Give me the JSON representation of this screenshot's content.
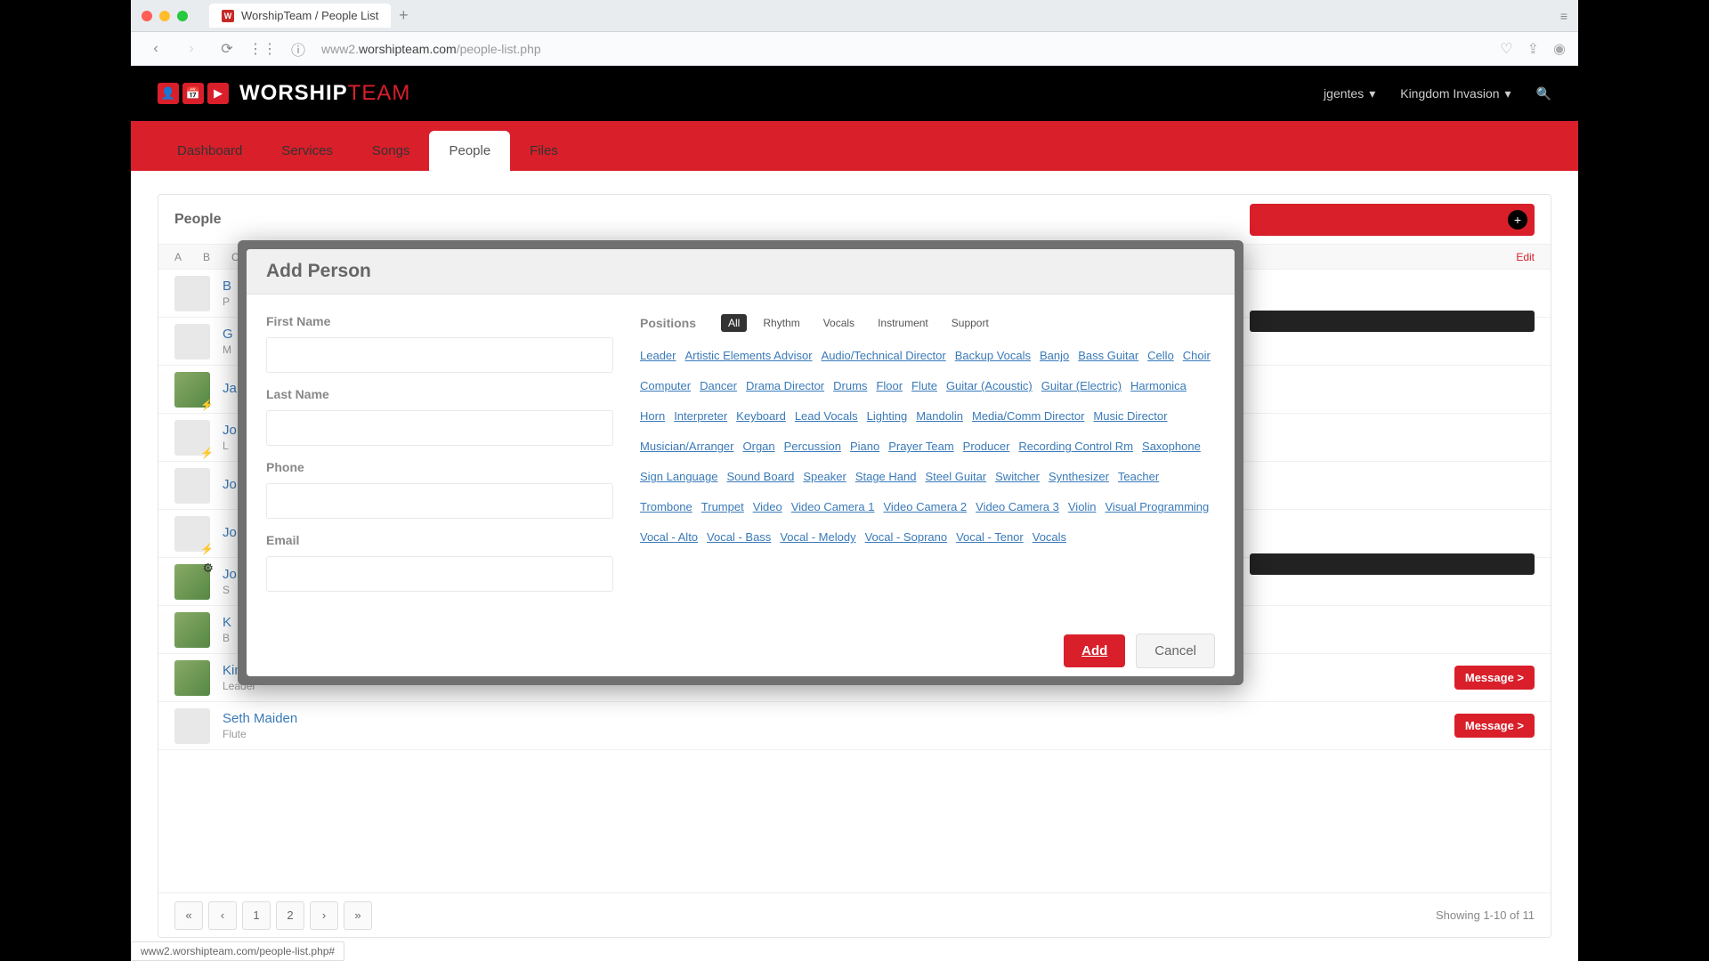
{
  "browser": {
    "tab_title": "WorshipTeam / People List",
    "url_prefix": "www2.",
    "url_domain": "worshipteam.com",
    "url_path": "/people-list.php",
    "status_bar": "www2.worshipteam.com/people-list.php#"
  },
  "header": {
    "logo_main": "WORSHIP",
    "logo_accent": "TEAM",
    "user": "jgentes",
    "org": "Kingdom Invasion"
  },
  "nav": {
    "tabs": [
      "Dashboard",
      "Services",
      "Songs",
      "People",
      "Files"
    ],
    "active": "People"
  },
  "panel": {
    "title": "People",
    "alpha": [
      "A",
      "B",
      "C"
    ],
    "edit": "Edit"
  },
  "people": [
    {
      "name": "B",
      "role": "P",
      "avatar": "blank",
      "bolt": false
    },
    {
      "name": "G",
      "role": "M",
      "avatar": "blank",
      "bolt": false
    },
    {
      "name": "Ja",
      "role": "",
      "avatar": "img",
      "bolt": true
    },
    {
      "name": "Jo",
      "role": "L",
      "avatar": "blank",
      "bolt": true
    },
    {
      "name": "Jo",
      "role": "",
      "avatar": "blank",
      "bolt": false
    },
    {
      "name": "Jo",
      "role": "",
      "avatar": "blank",
      "bolt": true
    },
    {
      "name": "Jo",
      "role": "S",
      "avatar": "img",
      "bolt": false,
      "gear": true
    },
    {
      "name": "K",
      "role": "B",
      "avatar": "img",
      "bolt": false
    },
    {
      "name": "Kim Gentes",
      "role": "Leader",
      "avatar": "img",
      "bolt": false,
      "msg": true
    },
    {
      "name": "Seth Maiden",
      "role": "Flute",
      "avatar": "blank",
      "bolt": false,
      "msg": true
    }
  ],
  "msg_button": "Message >",
  "pager": {
    "buttons": [
      "«",
      "‹",
      "1",
      "2",
      "›",
      "»"
    ],
    "showing": "Showing 1-10 of 11"
  },
  "modal": {
    "title": "Add Person",
    "fields": {
      "first_name": "First Name",
      "last_name": "Last Name",
      "phone": "Phone",
      "email": "Email"
    },
    "positions_label": "Positions",
    "filters": [
      "All",
      "Rhythm",
      "Vocals",
      "Instrument",
      "Support"
    ],
    "filter_active": "All",
    "tags": [
      "Leader",
      "Artistic Elements Advisor",
      "Audio/Technical Director",
      "Backup Vocals",
      "Banjo",
      "Bass Guitar",
      "Cello",
      "Choir",
      "Computer",
      "Dancer",
      "Drama Director",
      "Drums",
      "Floor",
      "Flute",
      "Guitar (Acoustic)",
      "Guitar (Electric)",
      "Harmonica",
      "Horn",
      "Interpreter",
      "Keyboard",
      "Lead Vocals",
      "Lighting",
      "Mandolin",
      "Media/Comm Director",
      "Music Director",
      "Musician/Arranger",
      "Organ",
      "Percussion",
      "Piano",
      "Prayer Team",
      "Producer",
      "Recording Control Rm",
      "Saxophone",
      "Sign Language",
      "Sound Board",
      "Speaker",
      "Stage Hand",
      "Steel Guitar",
      "Switcher",
      "Synthesizer",
      "Teacher",
      "Trombone",
      "Trumpet",
      "Video",
      "Video Camera 1",
      "Video Camera 2",
      "Video Camera 3",
      "Violin",
      "Visual Programming",
      "Vocal - Alto",
      "Vocal - Bass",
      "Vocal - Melody",
      "Vocal - Soprano",
      "Vocal - Tenor",
      "Vocals"
    ],
    "add": "Add",
    "cancel": "Cancel"
  }
}
